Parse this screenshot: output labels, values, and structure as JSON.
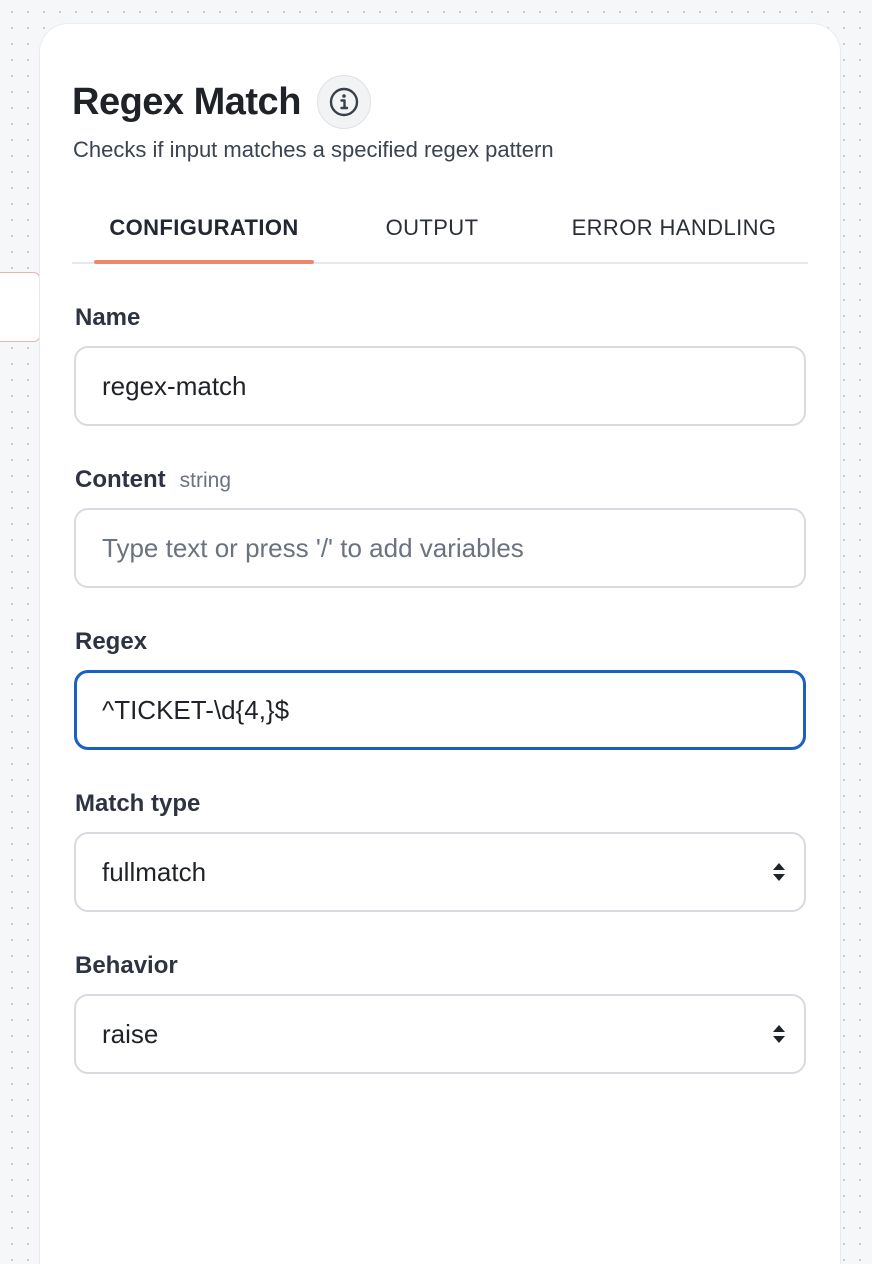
{
  "panel": {
    "title": "Regex Match",
    "subtitle": "Checks if input matches a specified regex pattern",
    "info_icon": "info-icon"
  },
  "tabs": [
    {
      "label": "CONFIGURATION",
      "active": true
    },
    {
      "label": "OUTPUT",
      "active": false
    },
    {
      "label": "ERROR HANDLING",
      "active": false
    }
  ],
  "fields": {
    "name": {
      "label": "Name",
      "value": "regex-match"
    },
    "content": {
      "label": "Content",
      "type_hint": "string",
      "placeholder": "Type text or press '/' to add variables"
    },
    "regex": {
      "label": "Regex",
      "value": "^TICKET-\\d{4,}$"
    },
    "match_type": {
      "label": "Match type",
      "value": "fullmatch"
    },
    "behavior": {
      "label": "Behavior",
      "value": "raise"
    }
  },
  "colors": {
    "tab_indicator": "#f0876b",
    "focus_border": "#1a5fc2",
    "title_text": "#1f2328"
  }
}
